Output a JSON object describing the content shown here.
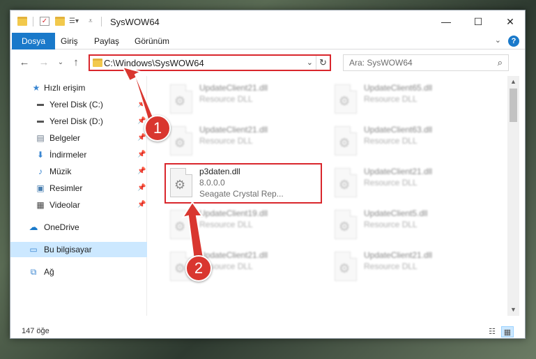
{
  "window": {
    "title": "SysWOW64",
    "minimize_glyph": "—",
    "maximize_glyph": "☐",
    "close_glyph": "✕"
  },
  "ribbon": {
    "tabs": [
      {
        "label": "Dosya",
        "active": true
      },
      {
        "label": "Giriş"
      },
      {
        "label": "Paylaş"
      },
      {
        "label": "Görünüm"
      }
    ],
    "help_glyph": "?"
  },
  "nav": {
    "address": "C:\\Windows\\SysWOW64",
    "search_placeholder": "Ara: SysWOW64"
  },
  "sidebar": {
    "items": [
      {
        "label": "Hızlı erişim",
        "icon": "star-icon",
        "pinned": false
      },
      {
        "label": "Yerel Disk (C:)",
        "icon": "drive-icon",
        "pinned": true
      },
      {
        "label": "Yerel Disk (D:)",
        "icon": "drive-icon",
        "pinned": true
      },
      {
        "label": "Belgeler",
        "icon": "document-icon",
        "pinned": true
      },
      {
        "label": "İndirmeler",
        "icon": "download-icon",
        "pinned": true
      },
      {
        "label": "Müzik",
        "icon": "music-icon",
        "pinned": true
      },
      {
        "label": "Resimler",
        "icon": "picture-icon",
        "pinned": true
      },
      {
        "label": "Videolar",
        "icon": "video-icon",
        "pinned": true
      },
      {
        "label": "OneDrive",
        "icon": "cloud-icon",
        "pinned": false
      },
      {
        "label": "Bu bilgisayar",
        "icon": "computer-icon",
        "pinned": false,
        "selected": true
      },
      {
        "label": "Ağ",
        "icon": "network-icon",
        "pinned": false
      }
    ]
  },
  "files": [
    {
      "name": "UpdateClient21.dll",
      "sub": "Resource DLL",
      "blurred": true
    },
    {
      "name": "UpdateClient65.dll",
      "sub": "Resource DLL",
      "blurred": true
    },
    {
      "name": "UpdateClient21.dll",
      "sub": "Resource DLL",
      "blurred": true
    },
    {
      "name": "UpdateClient63.dll",
      "sub": "Resource DLL",
      "blurred": true
    },
    {
      "name": "p3daten.dll",
      "sub": "8.0.0.0",
      "sub2": "Seagate Crystal Rep...",
      "blurred": false
    },
    {
      "name": "UpdateClient21.dll",
      "sub": "Resource DLL",
      "blurred": true
    },
    {
      "name": "UpdateClient19.dll",
      "sub": "Resource DLL",
      "blurred": true
    },
    {
      "name": "UpdateClient5.dll",
      "sub": "Resource DLL",
      "blurred": true
    },
    {
      "name": "UpdateClient21.dll",
      "sub": "Resource DLL",
      "blurred": true
    },
    {
      "name": "UpdateClient21.dll",
      "sub": "Resource DLL",
      "blurred": true
    }
  ],
  "status": {
    "item_count": "147 öğe"
  },
  "annotations": {
    "badge1": "1",
    "badge2": "2",
    "color": "#d9262c"
  }
}
